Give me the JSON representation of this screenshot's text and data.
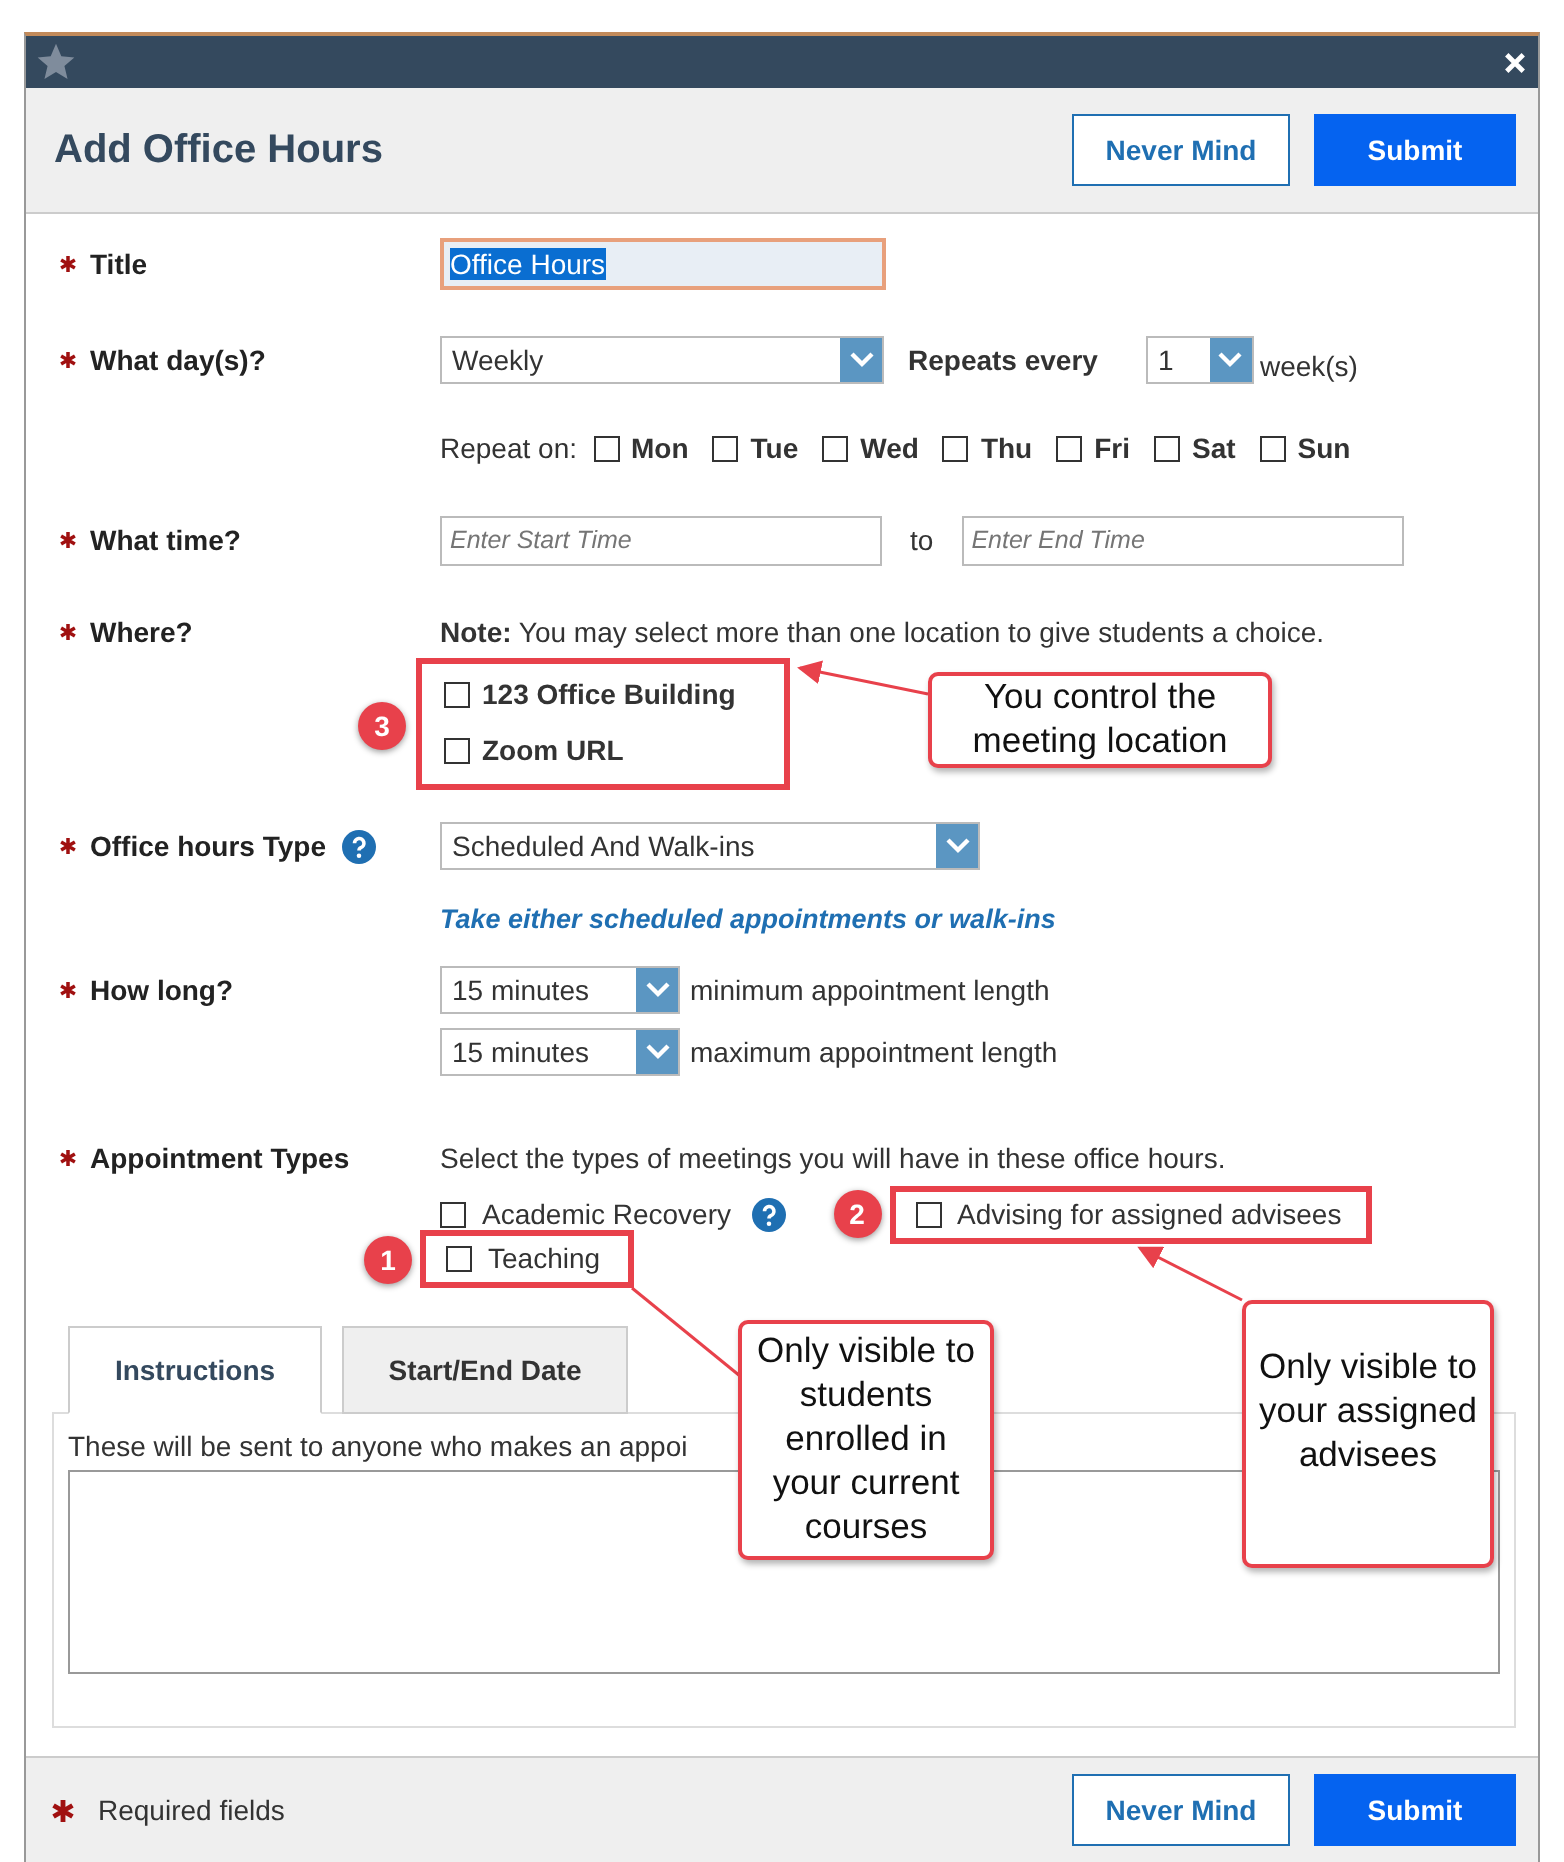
{
  "dialog": {
    "title": "Add Office Hours",
    "buttons": [
      {
        "label": "Never Mind",
        "kind": "secondary"
      },
      {
        "label": "Submit",
        "kind": "primary"
      }
    ]
  },
  "title_field": {
    "label": "Title",
    "required": true,
    "value": "Office Hours"
  },
  "day_field": {
    "label": "What day(s)?",
    "required": true,
    "value": "Weekly",
    "repeats_label": "Repeats every",
    "repeats_value": "1",
    "repeats_unit": "week(s)",
    "repeat_on_label": "Repeat on:",
    "days": [
      {
        "label": "Mon",
        "checked": false
      },
      {
        "label": "Tue",
        "checked": false
      },
      {
        "label": "Wed",
        "checked": false
      },
      {
        "label": "Thu",
        "checked": false
      },
      {
        "label": "Fri",
        "checked": false
      },
      {
        "label": "Sat",
        "checked": false
      },
      {
        "label": "Sun",
        "checked": false
      }
    ]
  },
  "time_field": {
    "label": "What time?",
    "required": true,
    "start_placeholder": "Enter Start Time",
    "separator": "to",
    "end_placeholder": "Enter End Time"
  },
  "where_field": {
    "label": "Where?",
    "required": true,
    "note": "**Note:** You may select more than one location to give students a choice.",
    "locations": [
      {
        "label": "123 Office Building",
        "checked": false
      },
      {
        "label": "Zoom URL",
        "checked": false
      }
    ]
  },
  "type_field": {
    "label": "Office hours Type",
    "required": true,
    "value": "Scheduled And Walk-ins",
    "hint": "Take either scheduled appointments or walk-ins"
  },
  "length_field": {
    "label": "How long?",
    "required": true,
    "rows": [
      {
        "value": "15 minutes",
        "caption": "minimum appointment length"
      },
      {
        "value": "15 minutes",
        "caption": "maximum appointment length"
      }
    ]
  },
  "appointment_field": {
    "label": "Appointment Types",
    "required": true,
    "intro": "Select the types of meetings you will have in these office hours.",
    "options": [
      {
        "label": "Academic Recovery",
        "checked": false
      },
      {
        "label": "Advising for assigned advisees",
        "checked": false
      },
      {
        "label": "Teaching",
        "checked": false
      }
    ]
  },
  "tabs": [
    {
      "label": "Instructions",
      "selected": true
    },
    {
      "label": "Start/End Date",
      "selected": false
    }
  ],
  "instructions": {
    "text": "These will be sent to anyone who makes an appoi"
  },
  "footer": {
    "required_note": "Required fields",
    "buttons": [
      {
        "label": "Never Mind",
        "kind": "secondary"
      },
      {
        "label": "Submit",
        "kind": "primary"
      }
    ]
  },
  "markers": [
    {
      "number": "3"
    },
    {
      "number": "2"
    },
    {
      "number": "1"
    }
  ],
  "callouts": [
    {
      "text": "You control the meeting location"
    },
    {
      "text": "Only visible to students enrolled in your current courses"
    },
    {
      "text": "Only visible to your assigned advisees"
    }
  ]
}
